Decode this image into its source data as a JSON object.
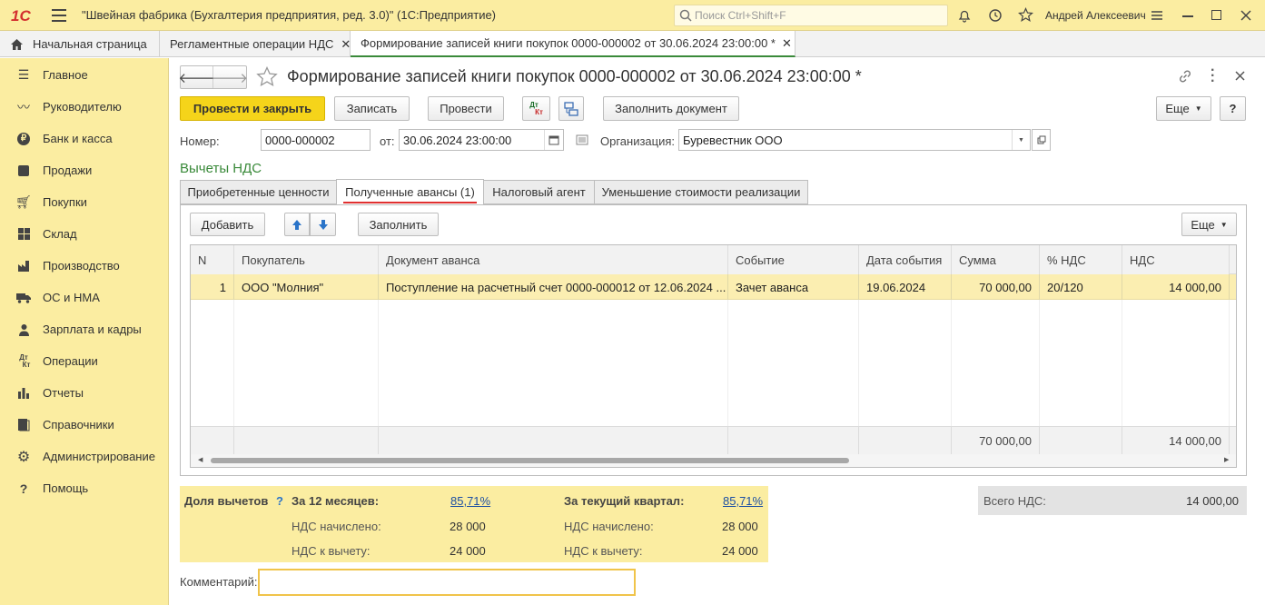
{
  "app": {
    "title": "\"Швейная фабрика (Бухгалтерия предприятия, ред. 3.0)\"  (1С:Предприятие)",
    "search_placeholder": "Поиск Ctrl+Shift+F",
    "user": "Андрей Алексеевич"
  },
  "open_tabs": [
    {
      "label": "Начальная страница"
    },
    {
      "label": "Регламентные операции НДС"
    },
    {
      "label": "Формирование записей книги покупок 0000-000002 от 30.06.2024 23:00:00 *"
    }
  ],
  "sidebar": {
    "items": [
      {
        "label": "Главное",
        "icon": "menu-icon"
      },
      {
        "label": "Руководителю",
        "icon": "trend-icon"
      },
      {
        "label": "Банк и касса",
        "icon": "ruble-icon"
      },
      {
        "label": "Продажи",
        "icon": "bag-icon"
      },
      {
        "label": "Покупки",
        "icon": "cart-icon"
      },
      {
        "label": "Склад",
        "icon": "grid-icon"
      },
      {
        "label": "Производство",
        "icon": "factory-icon"
      },
      {
        "label": "ОС и НМА",
        "icon": "truck-icon"
      },
      {
        "label": "Зарплата и кадры",
        "icon": "people-icon"
      },
      {
        "label": "Операции",
        "icon": "dtkt-icon"
      },
      {
        "label": "Отчеты",
        "icon": "bar-chart-icon"
      },
      {
        "label": "Справочники",
        "icon": "book-icon"
      },
      {
        "label": "Администрирование",
        "icon": "gear-icon"
      },
      {
        "label": "Помощь",
        "icon": "question-icon"
      }
    ]
  },
  "form": {
    "title": "Формирование записей книги покупок 0000-000002 от 30.06.2024 23:00:00 *",
    "buttons": {
      "post_close": "Провести и закрыть",
      "save": "Записать",
      "post": "Провести",
      "dtkt_top": "Дт",
      "dtkt_bottom": "Кт",
      "fill_document": "Заполнить документ",
      "more": "Еще",
      "help": "?"
    },
    "number_label": "Номер:",
    "number_value": "0000-000002",
    "date_label": "от:",
    "date_value": "30.06.2024 23:00:00",
    "org_label": "Организация:",
    "org_value": "Буревестник ООО",
    "section_title": "Вычеты НДС",
    "tabs": [
      {
        "label": "Приобретенные ценности"
      },
      {
        "label": "Полученные авансы (1)"
      },
      {
        "label": "Налоговый агент"
      },
      {
        "label": "Уменьшение стоимости реализации"
      }
    ],
    "table_buttons": {
      "add": "Добавить",
      "fill": "Заполнить",
      "more": "Еще"
    },
    "table": {
      "columns": [
        "N",
        "Покупатель",
        "Документ аванса",
        "Событие",
        "Дата события",
        "Сумма",
        "% НДС",
        "НДС"
      ],
      "rows": [
        {
          "n": "1",
          "buyer": "ООО \"Молния\"",
          "doc": "Поступление на расчетный счет 0000-000012 от 12.06.2024 ...",
          "event": "Зачет аванса",
          "date": "19.06.2024",
          "sum": "70 000,00",
          "rate": "20/120",
          "vat": "14 000,00"
        }
      ],
      "footer": {
        "sum": "70 000,00",
        "vat": "14 000,00"
      }
    },
    "deductions": {
      "share_label": "Доля вычетов",
      "share_help": "?",
      "m12_title": "За 12 месяцев:",
      "m12_percent": "85,71%",
      "q_title": "За текущий квартал:",
      "q_percent": "85,71%",
      "accrued_label": "НДС начислено:",
      "deductible_label": "НДС к вычету:",
      "m12_accrued": "28 000",
      "m12_deductible": "24 000",
      "q_accrued": "28 000",
      "q_deductible": "24 000"
    },
    "total_vat_label": "Всего НДС:",
    "total_vat_value": "14 000,00",
    "comment_label": "Комментарий:",
    "comment_value": ""
  },
  "colors": {
    "accent_yellow": "#fbeda1",
    "primary_button": "#f5d41a",
    "tab_underline": "#e03030",
    "green_title": "#3a8a3a"
  }
}
